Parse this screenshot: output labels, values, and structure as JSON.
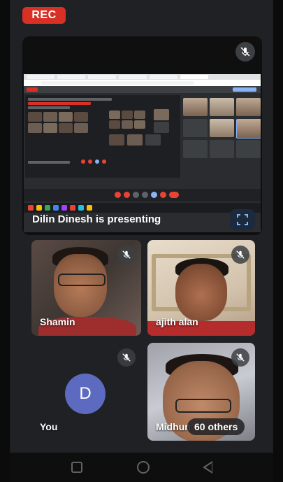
{
  "recording": {
    "label": "REC"
  },
  "presentation": {
    "status_text": "Dilin Dinesh is presenting"
  },
  "participants": [
    {
      "name": "Shamin",
      "muted": true
    },
    {
      "name": "ajith alan",
      "muted": true
    },
    {
      "name": "You",
      "avatar_letter": "D",
      "muted": true
    },
    {
      "name": "Midhun",
      "muted": true
    }
  ],
  "others": {
    "label": "60 others"
  },
  "icons": {
    "mic_off": "mic-off-icon",
    "fullscreen": "fullscreen-icon",
    "nav_recents": "recents-icon",
    "nav_home": "home-icon",
    "nav_back": "back-icon"
  },
  "colors": {
    "rec": "#d93025",
    "avatar": "#5c6bc0",
    "background": "#202124"
  }
}
